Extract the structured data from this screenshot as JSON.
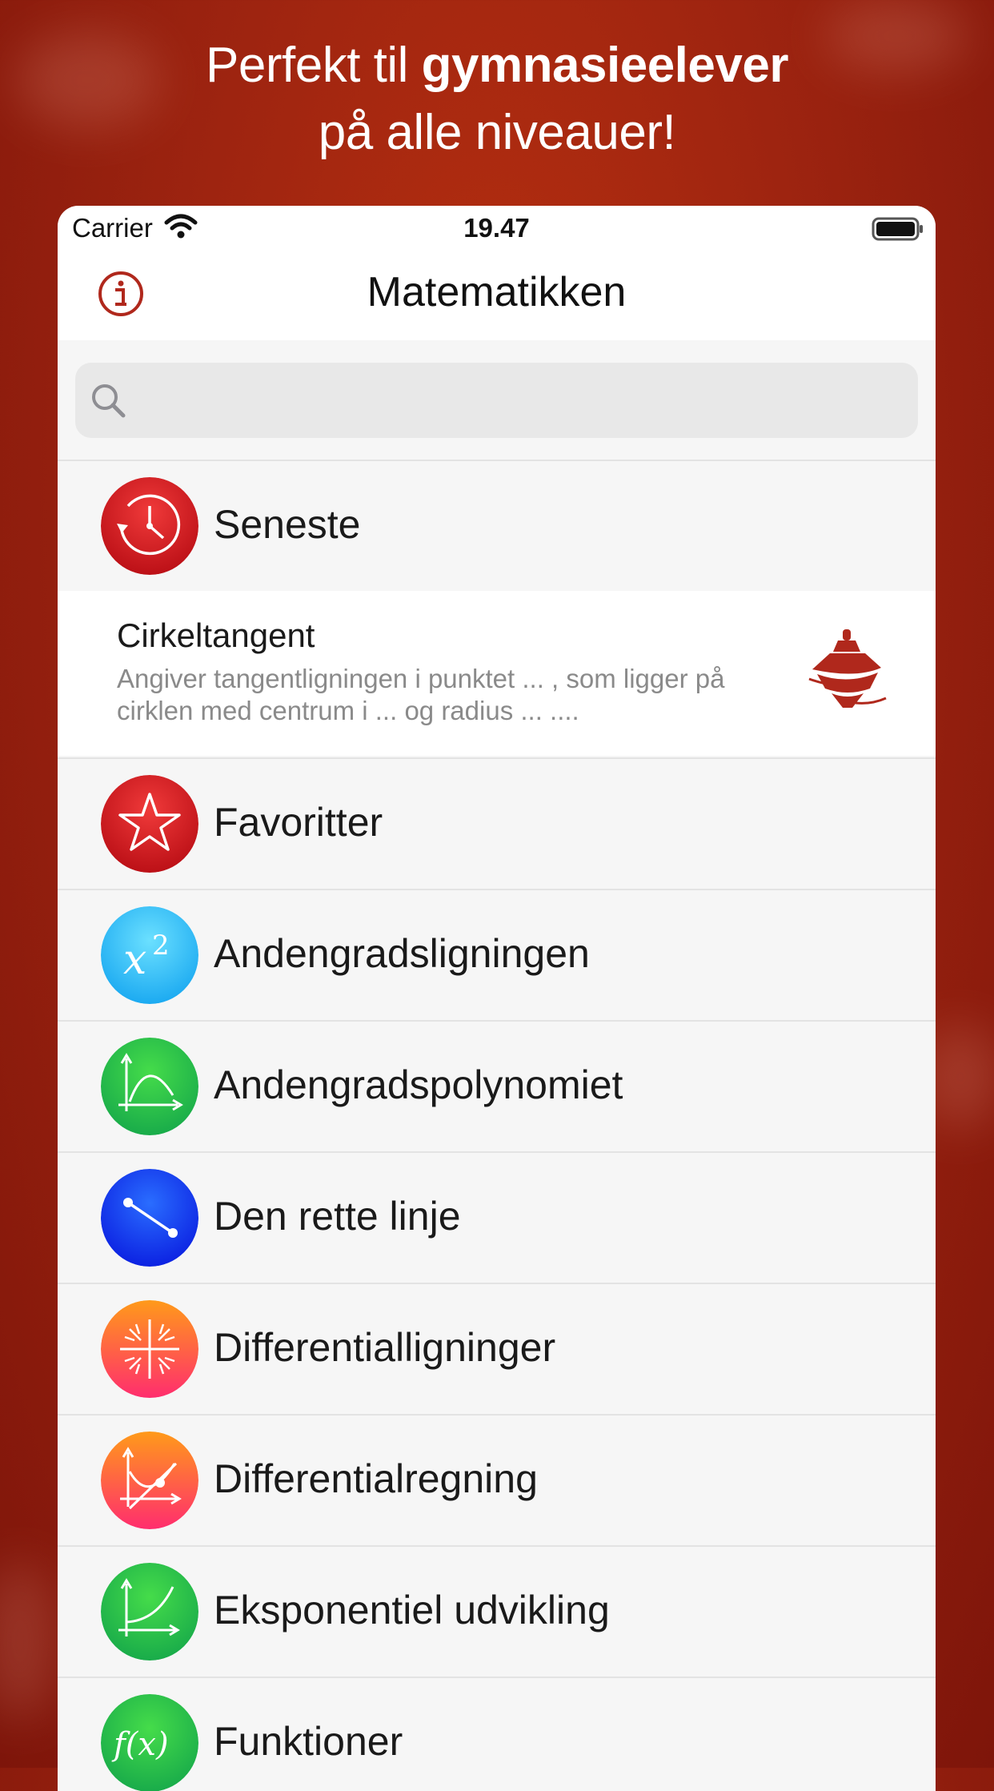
{
  "headline": {
    "line1_normal": "Perfekt til",
    "line1_bold": "gymnasieelever",
    "line2": "på alle niveauer!"
  },
  "status": {
    "carrier": "Carrier",
    "time": "19.47"
  },
  "nav": {
    "title": "Matematikken",
    "info_icon": "info-icon"
  },
  "search": {
    "placeholder": "",
    "icon": "search-icon"
  },
  "recent_header": {
    "label": "Seneste",
    "icon": "clock-history-icon"
  },
  "recent_item": {
    "title": "Cirkeltangent",
    "description": "Angiver tangentligningen i punktet ... , som ligger på cirklen med centrum i ... og radius ... ....",
    "icon": "spinning-top-icon"
  },
  "categories": [
    {
      "label": "Favoritter",
      "icon": "star-icon"
    },
    {
      "label": "Andengradsligningen",
      "icon": "x-squared-icon"
    },
    {
      "label": "Andengradspolynomiet",
      "icon": "parabola-graph-icon"
    },
    {
      "label": "Den rette linje",
      "icon": "line-segment-icon"
    },
    {
      "label": "Differentialligninger",
      "icon": "direction-field-icon"
    },
    {
      "label": "Differentialregning",
      "icon": "tangent-graph-icon"
    },
    {
      "label": "Eksponentiel udvikling",
      "icon": "exponential-graph-icon"
    },
    {
      "label": "Funktioner",
      "icon": "function-fx-icon"
    }
  ],
  "colors": {
    "brand_red": "#b8300f",
    "info_red": "#b0281c"
  }
}
